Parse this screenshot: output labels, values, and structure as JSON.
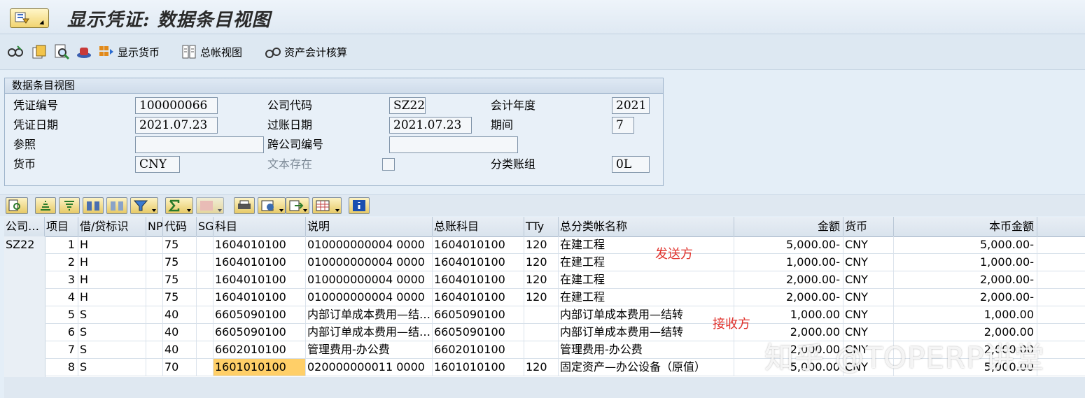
{
  "title": "显示凭证: 数据条目视图",
  "toolbar": {
    "display_currency": "显示货币",
    "gl_view": "总帐视图",
    "asset_accounting": "资产会计核算"
  },
  "header_panel": {
    "title": "数据条目视图",
    "doc_no_label": "凭证编号",
    "doc_no": "100000066",
    "company_label": "公司代码",
    "company": "SZ22",
    "fiscal_year_label": "会计年度",
    "fiscal_year": "2021",
    "doc_date_label": "凭证日期",
    "doc_date": "2021.07.23",
    "posting_date_label": "过账日期",
    "posting_date": "2021.07.23",
    "period_label": "期间",
    "period": "7",
    "reference_label": "参照",
    "reference": "",
    "intercompany_label": "跨公司编号",
    "intercompany": "",
    "currency_label": "货币",
    "currency": "CNY",
    "text_exists_label": "文本存在",
    "ledger_group_label": "分类账组",
    "ledger_group": "0L"
  },
  "table": {
    "headers": {
      "company": "公司…",
      "item": "项目",
      "dc": "借/贷标识",
      "np": "NP",
      "code": "代码",
      "sg": "SG",
      "account": "科目",
      "desc": "说明",
      "gl": "总账科目",
      "tty": "TTy",
      "gl_name": "总分类帐名称",
      "amount": "金额",
      "curr": "货币",
      "local_amount": "本币金额"
    },
    "company_value": "SZ22",
    "rows": [
      {
        "item": "1",
        "dc": "H",
        "code": "75",
        "account": "1604010100",
        "desc": "010000000004 0000",
        "gl": "1604010100",
        "tty": "120",
        "gl_name": "在建工程",
        "amount": "5,000.00-",
        "curr": "CNY",
        "local_amount": "5,000.00-"
      },
      {
        "item": "2",
        "dc": "H",
        "code": "75",
        "account": "1604010100",
        "desc": "010000000004 0000",
        "gl": "1604010100",
        "tty": "120",
        "gl_name": "在建工程",
        "amount": "1,000.00-",
        "curr": "CNY",
        "local_amount": "1,000.00-"
      },
      {
        "item": "3",
        "dc": "H",
        "code": "75",
        "account": "1604010100",
        "desc": "010000000004 0000",
        "gl": "1604010100",
        "tty": "120",
        "gl_name": "在建工程",
        "amount": "2,000.00-",
        "curr": "CNY",
        "local_amount": "2,000.00-"
      },
      {
        "item": "4",
        "dc": "H",
        "code": "75",
        "account": "1604010100",
        "desc": "010000000004 0000",
        "gl": "1604010100",
        "tty": "120",
        "gl_name": "在建工程",
        "amount": "2,000.00-",
        "curr": "CNY",
        "local_amount": "2,000.00-"
      },
      {
        "item": "5",
        "dc": "S",
        "code": "40",
        "account": "6605090100",
        "desc": "内部订单成本费用—结…",
        "gl": "6605090100",
        "tty": "",
        "gl_name": "内部订单成本费用—结转",
        "amount": "1,000.00",
        "curr": "CNY",
        "local_amount": "1,000.00"
      },
      {
        "item": "6",
        "dc": "S",
        "code": "40",
        "account": "6605090100",
        "desc": "内部订单成本费用—结…",
        "gl": "6605090100",
        "tty": "",
        "gl_name": "内部订单成本费用—结转",
        "amount": "2,000.00",
        "curr": "CNY",
        "local_amount": "2,000.00"
      },
      {
        "item": "7",
        "dc": "S",
        "code": "40",
        "account": "6602010100",
        "desc": "管理费用-办公费",
        "gl": "6602010100",
        "tty": "",
        "gl_name": "管理费用-办公费",
        "amount": "2,000.00",
        "curr": "CNY",
        "local_amount": "2,000.00"
      },
      {
        "item": "8",
        "dc": "S",
        "code": "70",
        "account": "1601010100",
        "desc": "020000000011 0000",
        "gl": "1601010100",
        "tty": "120",
        "gl_name": "固定资产—办公设备（原值）",
        "amount": "5,000.00",
        "curr": "CNY",
        "local_amount": "5,000.00"
      }
    ]
  },
  "annotations": {
    "sender": "发送方",
    "receiver": "接收方"
  },
  "watermark": "知乎 @TOPERP讲堂",
  "colors": {
    "highlight": "#ffcf68",
    "annotation": "#e0302a"
  }
}
